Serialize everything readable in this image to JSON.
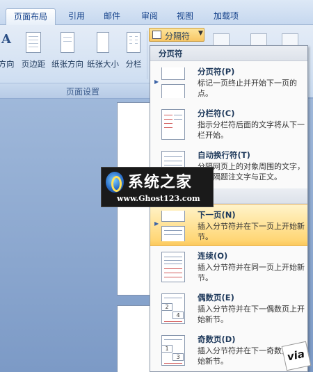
{
  "tabs": [
    {
      "label": "页面布局",
      "active": true
    },
    {
      "label": "引用"
    },
    {
      "label": "邮件"
    },
    {
      "label": "审阅"
    },
    {
      "label": "视图"
    },
    {
      "label": "加载项"
    }
  ],
  "ribbon": {
    "buttons": [
      "方向",
      "页边距",
      "纸张方向",
      "纸张大小",
      "分栏"
    ],
    "group_label": "页面设置",
    "split_button_label": "分隔符"
  },
  "menu": {
    "section1_header": "分页符",
    "section2_header": "分节符",
    "items": [
      {
        "title": "分页符(P)",
        "desc": "标记一页终止并开始下一页的点。",
        "highlighted": false
      },
      {
        "title": "分栏符(C)",
        "desc": "指示分栏符后面的文字将从下一栏开始。",
        "highlighted": false
      },
      {
        "title": "自动换行符(T)",
        "desc": "分隔网页上的对象周围的文字，如分隔题注文字与正文。",
        "highlighted": false
      },
      {
        "title": "下一页(N)",
        "desc": "插入分节符并在下一页上开始新节。",
        "highlighted": true
      },
      {
        "title": "连续(O)",
        "desc": "插入分节符并在同一页上开始新节。",
        "highlighted": false
      },
      {
        "title": "偶数页(E)",
        "desc": "插入分节符并在下一偶数页上开始新节。",
        "highlighted": false
      },
      {
        "title": "奇数页(D)",
        "desc": "插入分节符并在下一奇数页上开始新节。",
        "highlighted": false
      }
    ]
  },
  "watermark": {
    "title": "系统之家",
    "url": "www.Ghost123.com"
  },
  "corner_badge": "via",
  "colors": {
    "highlight": "#ffd777",
    "ribbon": "#d6e3f3",
    "doc_background": "#8ea9cf"
  }
}
